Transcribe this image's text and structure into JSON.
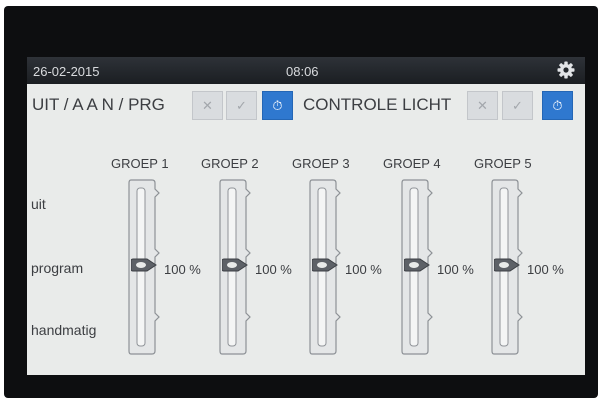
{
  "status": {
    "date": "26-02-2015",
    "time": "08:06",
    "settings_icon": "gear-icon"
  },
  "modes": [
    {
      "label": "UIT / A A N / PRG",
      "buttons": [
        "✕",
        "✓",
        "⏱"
      ],
      "active": 2
    },
    {
      "label": "CONTROLE LICHT",
      "buttons": [
        "✕",
        "✓",
        "⏱"
      ],
      "active": 2
    }
  ],
  "rows": {
    "uit": "uit",
    "program": "program",
    "handmatig": "handmatig"
  },
  "groups": [
    {
      "name": "GROEP 1",
      "value": "100 %",
      "position": "program"
    },
    {
      "name": "GROEP 2",
      "value": "100 %",
      "position": "program"
    },
    {
      "name": "GROEP 3",
      "value": "100 %",
      "position": "program"
    },
    {
      "name": "GROEP 4",
      "value": "100 %",
      "position": "program"
    },
    {
      "name": "GROEP 5",
      "value": "100 %",
      "position": "program"
    }
  ]
}
